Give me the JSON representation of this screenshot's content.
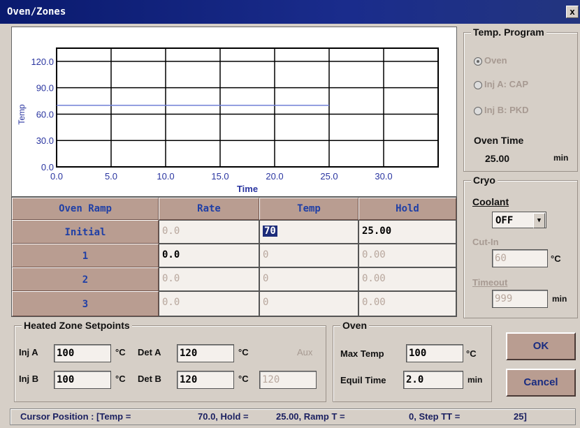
{
  "window": {
    "title": "Oven/Zones",
    "close": "x"
  },
  "chart_data": {
    "type": "line",
    "xlabel": "Time",
    "ylabel": "Temp",
    "xlim": [
      0,
      35
    ],
    "ylim": [
      0,
      135
    ],
    "x_ticks": [
      "0.0",
      "5.0",
      "10.0",
      "15.0",
      "20.0",
      "25.0",
      "30.0"
    ],
    "y_ticks": [
      "0.0",
      "30.0",
      "60.0",
      "90.0",
      "120.0"
    ],
    "series": [
      {
        "x": [
          0,
          25
        ],
        "y": [
          70,
          70
        ]
      }
    ],
    "color": "#6f7fd6",
    "grid": true
  },
  "ramp_table": {
    "headers": [
      "Oven Ramp",
      "Rate",
      "Temp",
      "Hold"
    ],
    "rows": [
      {
        "label": "Initial",
        "rate": "0.0",
        "temp": "70",
        "hold": "25.00"
      },
      {
        "label": "1",
        "rate": "0.0",
        "temp": "0",
        "hold": "0.00"
      },
      {
        "label": "2",
        "rate": "0.0",
        "temp": "0",
        "hold": "0.00"
      },
      {
        "label": "3",
        "rate": "0.0",
        "temp": "0",
        "hold": "0.00"
      }
    ]
  },
  "temp_program": {
    "title": "Temp. Program",
    "options": [
      "Oven",
      "Inj A: CAP",
      "Inj B: PKD"
    ],
    "selected": "Oven",
    "oven_time_label": "Oven Time",
    "oven_time_value": "25.00",
    "oven_time_unit": "min"
  },
  "cryo": {
    "title": "Cryo",
    "coolant_label": "Coolant",
    "coolant_value": "OFF",
    "cutin_label": "Cut-In",
    "cutin_value": "60",
    "cutin_unit": "°C",
    "timeout_label": "Timeout",
    "timeout_value": "999",
    "timeout_unit": "min"
  },
  "heated_zones": {
    "title": "Heated Zone Setpoints",
    "inj_a_label": "Inj A",
    "inj_a_value": "100",
    "inj_b_label": "Inj B",
    "inj_b_value": "100",
    "det_a_label": "Det A",
    "det_a_value": "120",
    "det_b_label": "Det B",
    "det_b_value": "120",
    "aux_label": "Aux",
    "aux_value": "120",
    "unit": "°C"
  },
  "oven": {
    "title": "Oven",
    "max_temp_label": "Max Temp",
    "max_temp_value": "100",
    "max_temp_unit": "°C",
    "equil_label": "Equil Time",
    "equil_value": "2.0",
    "equil_unit": "min"
  },
  "buttons": {
    "ok": "OK",
    "cancel": "Cancel"
  },
  "status": {
    "cursor_label": "Cursor Position : [Temp =",
    "temp": "70.0, Hold =",
    "hold": "25.00, Ramp T =",
    "ramp": "0, Step TT =",
    "step": "25]"
  }
}
